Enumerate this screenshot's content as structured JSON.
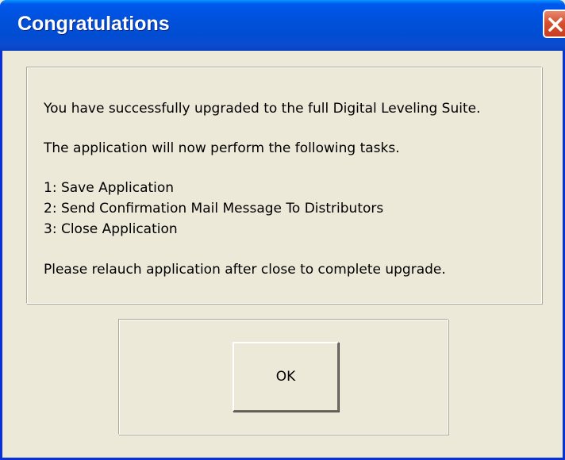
{
  "window": {
    "title": "Congratulations"
  },
  "icons": {
    "close": "close-icon"
  },
  "message": {
    "line1": "You have successfully upgraded to the full Digital Leveling Suite.",
    "line2": "The application will now perform the following tasks.",
    "tasks": [
      "1: Save Application",
      "2: Send Confirmation Mail Message To Distributors",
      "3: Close Application"
    ],
    "line4": "Please relauch application after close to complete upgrade."
  },
  "buttons": {
    "ok_label": "OK"
  },
  "colors": {
    "titlebar": "#0054e3",
    "close_button": "#d5502f",
    "dialog_background": "#ece9d8"
  }
}
